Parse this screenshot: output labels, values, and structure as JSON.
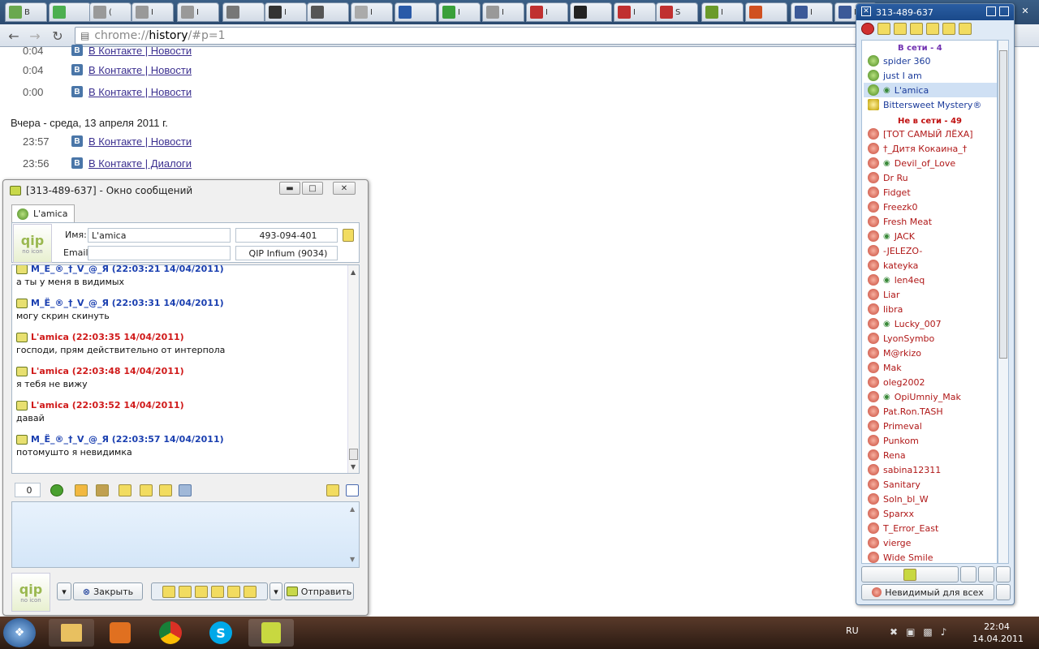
{
  "browser": {
    "url_prefix": "chrome://",
    "url_host": "history",
    "url_rest": "/#p=1",
    "tabs": [
      {
        "label": "B",
        "color": "#6aa84f"
      },
      {
        "label": "",
        "color": "#4caf50"
      },
      {
        "label": "(",
        "color": "#999"
      },
      {
        "label": "I",
        "color": "#999"
      },
      {
        "label": "I",
        "color": "#999"
      },
      {
        "label": "",
        "color": "#777"
      },
      {
        "label": "I",
        "color": "#333"
      },
      {
        "label": "",
        "color": "#555"
      },
      {
        "label": "I",
        "color": "#aaa"
      },
      {
        "label": "",
        "color": "#2a5aa8"
      },
      {
        "label": "I",
        "color": "#3aa03a"
      },
      {
        "label": "I",
        "color": "#999"
      },
      {
        "label": "I",
        "color": "#c03030"
      },
      {
        "label": "",
        "color": "#222"
      },
      {
        "label": "I",
        "color": "#c03030"
      },
      {
        "label": "S",
        "color": "#c03030"
      },
      {
        "label": "I",
        "color": "#6a9a2a"
      },
      {
        "label": "",
        "color": "#d05020"
      },
      {
        "label": "I",
        "color": "#3b5998"
      },
      {
        "label": "I",
        "color": "#3b5998"
      }
    ]
  },
  "history": {
    "rows_top": [
      {
        "time": "0:04",
        "title": "В Контакте | Новости"
      },
      {
        "time": "0:04",
        "title": "В Контакте | Новости"
      },
      {
        "time": "0:00",
        "title": "В Контакте | Новости"
      }
    ],
    "day_label": "Вчера - среда, 13 апреля 2011 г.",
    "rows_day": [
      {
        "time": "23:57",
        "title": "В Контакте | Новости"
      },
      {
        "time": "23:56",
        "title": "В Контакте | Диалоги"
      }
    ]
  },
  "msgwin": {
    "title": "[313-489-637] - Окно сообщений",
    "tab_label": "L'amica",
    "logo_text": "qip",
    "logo_sub": "no icon",
    "name_label": "Имя:",
    "name_value": "L'amica",
    "email_label": "Email:",
    "email_value": "",
    "uin": "493-094-401",
    "client": "QIP Infium (9034)",
    "messages": [
      {
        "dir": "out",
        "head": "M_Ё_®_†_V_@_Я (22:03:21 14/04/2011)",
        "text": "а ты у меня в видимых"
      },
      {
        "dir": "out",
        "head": "M_Ё_®_†_V_@_Я (22:03:31 14/04/2011)",
        "text": "могу скрин скинуть"
      },
      {
        "dir": "in",
        "head": "L'amica (22:03:35 14/04/2011)",
        "text": "господи, прям действительно от интерпола"
      },
      {
        "dir": "in",
        "head": "L'amica (22:03:48 14/04/2011)",
        "text": "я тебя не вижу"
      },
      {
        "dir": "in",
        "head": "L'amica (22:03:52 14/04/2011)",
        "text": "давай"
      },
      {
        "dir": "out",
        "head": "M_Ё_®_†_V_@_Я (22:03:57 14/04/2011)",
        "text": "потомушто я невидимка"
      }
    ],
    "char_count": "0",
    "close_label": "Закрыть",
    "send_label": "Отправить"
  },
  "clist": {
    "title": "313-489-637",
    "online_header": "В сети - 4",
    "offline_header": "Не в сети - 49",
    "online": [
      {
        "name": "spider 360",
        "eye": false,
        "kind": "on"
      },
      {
        "name": "just I am",
        "eye": false,
        "kind": "on"
      },
      {
        "name": "L'amica",
        "eye": true,
        "kind": "on"
      },
      {
        "name": "Bittersweet Mystery®",
        "eye": false,
        "kind": "yel"
      }
    ],
    "offline": [
      {
        "name": "[ТОТ САМЫЙ ЛЁХА]",
        "eye": false
      },
      {
        "name": "†_Дитя Кокаина_†",
        "eye": false
      },
      {
        "name": "Devil_of_Love",
        "eye": true
      },
      {
        "name": "Dr Ru",
        "eye": false
      },
      {
        "name": "Fidget",
        "eye": false
      },
      {
        "name": "Freezk0",
        "eye": false
      },
      {
        "name": "Fresh Meat",
        "eye": false
      },
      {
        "name": "JACK",
        "eye": true
      },
      {
        "name": "-JELEZO-",
        "eye": false
      },
      {
        "name": "kateyka",
        "eye": false
      },
      {
        "name": "len4eq",
        "eye": true
      },
      {
        "name": "Liar",
        "eye": false
      },
      {
        "name": "libra",
        "eye": false
      },
      {
        "name": "Lucky_007",
        "eye": true
      },
      {
        "name": "LyonSymbo",
        "eye": false
      },
      {
        "name": "M@rkizo",
        "eye": false
      },
      {
        "name": "Mak",
        "eye": false
      },
      {
        "name": "oleg2002",
        "eye": false
      },
      {
        "name": "OpiUmniy_Mak",
        "eye": true
      },
      {
        "name": "Pat.Ron.TASH",
        "eye": false
      },
      {
        "name": "Primeval",
        "eye": false
      },
      {
        "name": "Punkom",
        "eye": false
      },
      {
        "name": "Rena",
        "eye": false
      },
      {
        "name": "sabina12311",
        "eye": false
      },
      {
        "name": "Sanitary",
        "eye": false
      },
      {
        "name": "Soln_bl_W",
        "eye": false
      },
      {
        "name": "Sparxx",
        "eye": false
      },
      {
        "name": "T_Error_East",
        "eye": false
      },
      {
        "name": "vierge",
        "eye": false
      },
      {
        "name": "Wide Smile",
        "eye": false
      }
    ],
    "status_label": "Невидимый для всех"
  },
  "taskbar": {
    "lang": "RU",
    "time": "22:04",
    "date": "14.04.2011"
  }
}
